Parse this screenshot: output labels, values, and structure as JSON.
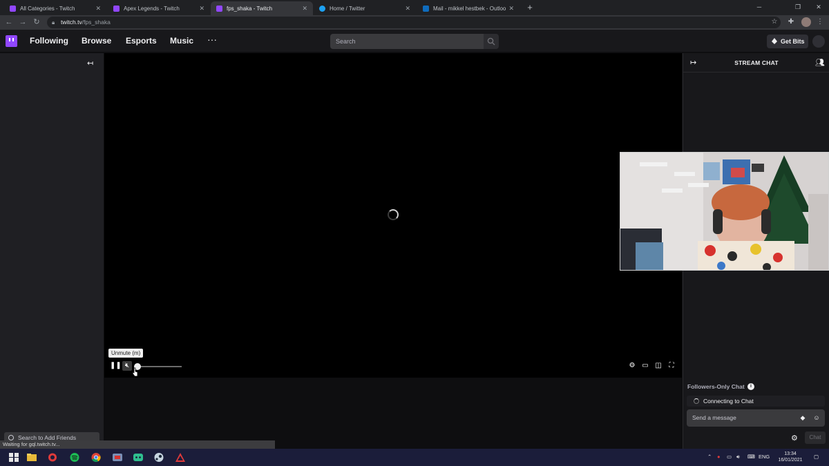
{
  "browser": {
    "tabs": [
      {
        "title": "All Categories - Twitch",
        "active": false,
        "favicon": "twitch-icon"
      },
      {
        "title": "Apex Legends - Twitch",
        "active": false,
        "favicon": "twitch-icon"
      },
      {
        "title": "fps_shaka - Twitch",
        "active": true,
        "favicon": "twitch-icon"
      },
      {
        "title": "Home / Twitter",
        "active": false,
        "favicon": "twitter-icon"
      },
      {
        "title": "Mail - mikkel hestbek - Outlook",
        "active": false,
        "favicon": "outlook-icon"
      }
    ],
    "url_domain": "twitch.tv",
    "url_path": "/fps_shaka",
    "status_text": "Waiting for gql.twitch.tv..."
  },
  "header": {
    "nav": [
      "Following",
      "Browse",
      "Esports",
      "Music"
    ],
    "more": "···",
    "search_placeholder": "Search",
    "get_bits": "Get Bits"
  },
  "sidebar": {
    "friends_search": "Search to Add Friends"
  },
  "player": {
    "tooltip": "Unmute (m)",
    "muted": true,
    "volume": 0
  },
  "chat": {
    "title": "STREAM CHAT",
    "followers_only": "Followers-Only Chat",
    "connecting": "Connecting to Chat",
    "placeholder": "Send a message",
    "send_button": "Chat"
  },
  "taskbar": {
    "language": "ENG",
    "time": "13:34",
    "date": "16/01/2021"
  },
  "colors": {
    "twitch_purple": "#9147ff",
    "background": "#0e0e10",
    "panel": "#18181b",
    "taskbar": "#1b1d3a"
  }
}
